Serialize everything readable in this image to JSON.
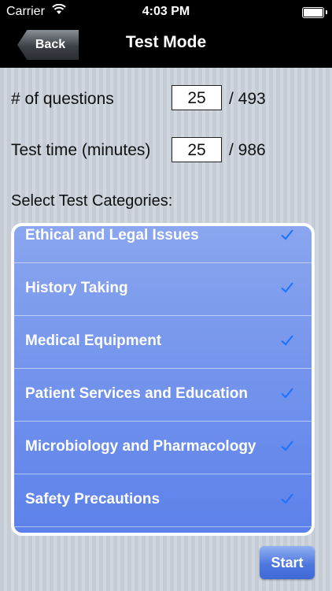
{
  "status_bar": {
    "carrier": "Carrier",
    "time": "4:03 PM"
  },
  "nav": {
    "back_label": "Back",
    "title": "Test Mode"
  },
  "questions": {
    "label": "# of questions",
    "value": "25",
    "total": "/ 493"
  },
  "test_time": {
    "label": "Test time (minutes)",
    "value": "25",
    "total": "/ 986"
  },
  "categories_label": "Select Test Categories:",
  "categories": [
    {
      "label": "Ethical and Legal Issues",
      "checked": true
    },
    {
      "label": "History Taking",
      "checked": true
    },
    {
      "label": "Medical Equipment",
      "checked": true
    },
    {
      "label": "Patient Services and Education",
      "checked": true
    },
    {
      "label": "Microbiology and Pharmacology",
      "checked": true
    },
    {
      "label": "Safety Precautions",
      "checked": true
    }
  ],
  "start_label": "Start",
  "colors": {
    "check": "#1a73ff",
    "list_top": "#8aa6ef",
    "list_bottom": "#5c81ea"
  }
}
